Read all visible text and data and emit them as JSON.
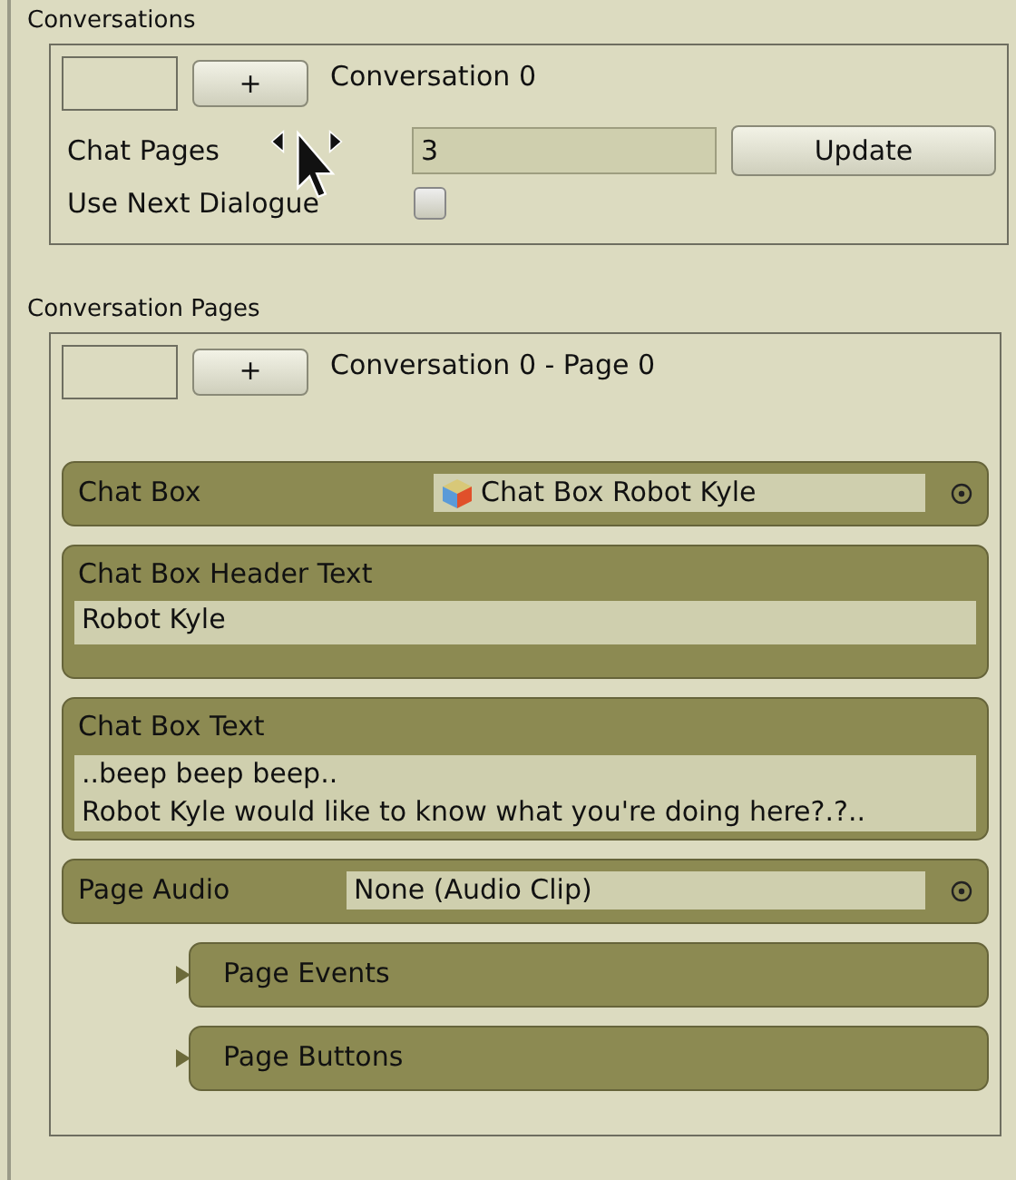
{
  "conversations": {
    "title": "Conversations",
    "add_button": "+",
    "label": "Conversation 0",
    "chat_pages": {
      "label": "Chat Pages",
      "value": "3",
      "button": "Update"
    },
    "use_next_dialogue": {
      "label": "Use Next Dialogue",
      "checked": false
    }
  },
  "conversation_pages": {
    "title": "Conversation Pages",
    "add_button": "+",
    "label": "Conversation 0 - Page 0",
    "fields": [
      {
        "kind": "object",
        "label": "Chat Box",
        "value": "Chat Box Robot Kyle",
        "has_icon": true
      },
      {
        "kind": "text",
        "label": "Chat Box Header Text",
        "lines": [
          "Robot Kyle"
        ]
      },
      {
        "kind": "text",
        "label": "Chat Box Text",
        "lines": [
          "..beep beep beep..",
          "Robot Kyle would like to know what you're doing here?.?.."
        ]
      },
      {
        "kind": "object",
        "label": "Page Audio",
        "value": "None (Audio Clip)",
        "has_icon": false
      },
      {
        "kind": "foldout",
        "label": "Page Events",
        "expanded": false
      },
      {
        "kind": "foldout",
        "label": "Page Buttons",
        "expanded": false
      }
    ]
  }
}
